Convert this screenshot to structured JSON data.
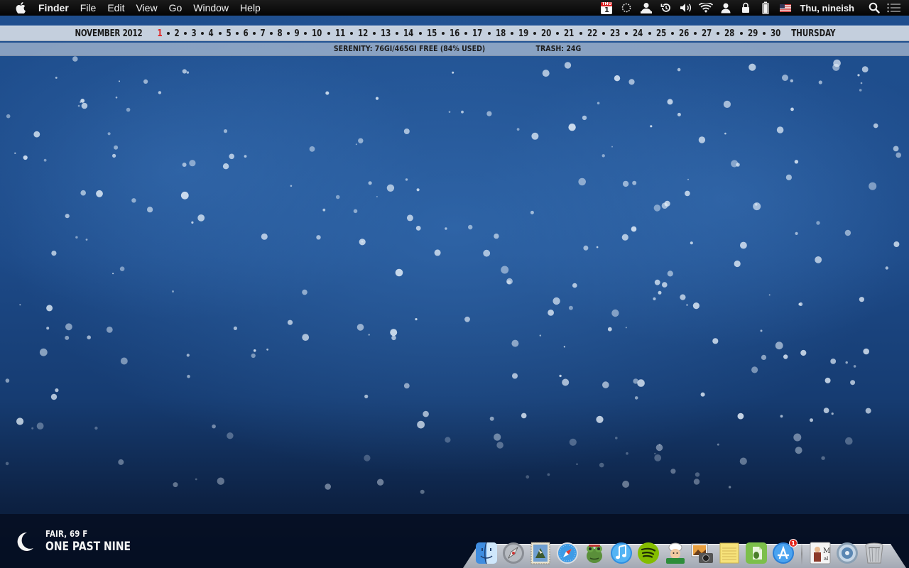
{
  "menubar": {
    "app_name": "Finder",
    "items": [
      "File",
      "Edit",
      "View",
      "Go",
      "Window",
      "Help"
    ],
    "status_icons": [
      "calendar-icon",
      "sync-spinner-icon",
      "user-account-icon",
      "time-machine-icon",
      "volume-icon",
      "wifi-icon",
      "user-icon",
      "lock-icon",
      "battery-icon",
      "us-flag-icon"
    ],
    "calendar_icon": {
      "weekday": "THU",
      "day": "1"
    },
    "clock": "Thu, nineish"
  },
  "calendar_strip": {
    "month": "NOVEMBER 2012",
    "days": [
      "1",
      "2",
      "3",
      "4",
      "5",
      "6",
      "7",
      "8",
      "9",
      "10",
      "11",
      "12",
      "13",
      "14",
      "15",
      "16",
      "17",
      "18",
      "19",
      "20",
      "21",
      "22",
      "23",
      "24",
      "25",
      "26",
      "27",
      "28",
      "29",
      "30"
    ],
    "today": "1",
    "today_color": "#e02020",
    "weekday": "THURSDAY"
  },
  "disk_strip": {
    "disk": "SERENITY: 76GI/465GI FREE (84% USED)",
    "trash": "TRASH: 24G"
  },
  "weather": {
    "condition": "FAIR, 69 F",
    "time_text": "ONE PAST NINE"
  },
  "dock": {
    "apps": [
      {
        "name": "finder-icon",
        "running": true
      },
      {
        "name": "launchpad-icon",
        "running": true
      },
      {
        "name": "mail-stamp-icon",
        "running": false
      },
      {
        "name": "safari-icon",
        "running": false
      },
      {
        "name": "frog-icon",
        "running": false
      },
      {
        "name": "itunes-icon",
        "running": false
      },
      {
        "name": "spotify-icon",
        "running": false
      },
      {
        "name": "chef-icon",
        "running": false
      },
      {
        "name": "photo-camera-icon",
        "running": false
      },
      {
        "name": "notes-icon",
        "running": false
      },
      {
        "name": "evernote-icon",
        "running": false
      },
      {
        "name": "app-store-icon",
        "running": false,
        "badge": "1"
      }
    ],
    "right_items": [
      "mail-document-icon",
      "downloads-stack-icon",
      "trash-icon"
    ]
  }
}
